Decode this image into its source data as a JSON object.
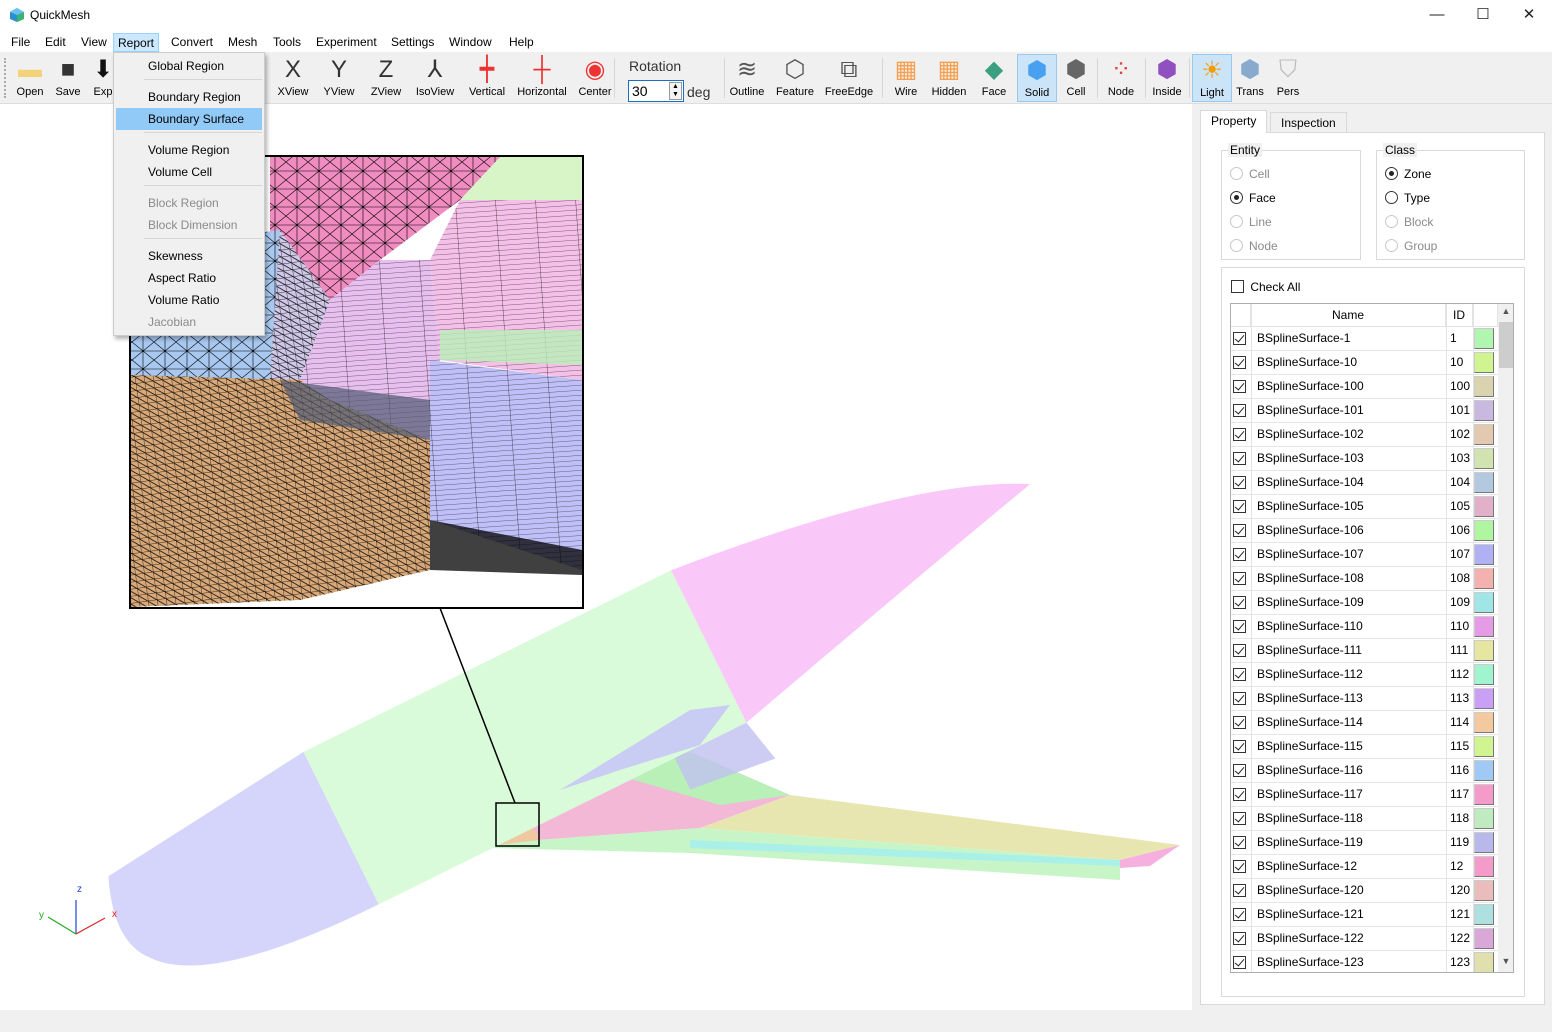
{
  "app": {
    "title": "QuickMesh",
    "window_controls": {
      "minimize": "—",
      "maximize": "☐",
      "close": "✕"
    }
  },
  "menu": [
    "File",
    "Edit",
    "View",
    "Report",
    "Convert",
    "Mesh",
    "Tools",
    "Experiment",
    "Settings",
    "Window",
    "Help"
  ],
  "active_menu": "Report",
  "report_menu": [
    {
      "label": "Global Region",
      "enabled": true
    },
    {
      "label": "Boundary Region",
      "enabled": true
    },
    {
      "label": "Boundary Surface",
      "enabled": true,
      "highlighted": true
    },
    {
      "label": "Volume Region",
      "enabled": true
    },
    {
      "label": "Volume Cell",
      "enabled": true
    },
    {
      "label": "Block Region",
      "enabled": false
    },
    {
      "label": "Block Dimension",
      "enabled": false
    },
    {
      "label": "Skewness",
      "enabled": true
    },
    {
      "label": "Aspect Ratio",
      "enabled": true
    },
    {
      "label": "Volume Ratio",
      "enabled": true
    },
    {
      "label": "Jacobian",
      "enabled": false
    }
  ],
  "toolbar": {
    "buttons": [
      {
        "label": "Open",
        "icon": "folder-icon"
      },
      {
        "label": "Save",
        "icon": "floppy-icon"
      },
      {
        "label": "Exp",
        "icon": "export-icon"
      },
      {
        "label": "XView",
        "icon": "x-view-icon"
      },
      {
        "label": "YView",
        "icon": "y-view-icon"
      },
      {
        "label": "ZView",
        "icon": "z-view-icon"
      },
      {
        "label": "IsoView",
        "icon": "iso-view-icon"
      },
      {
        "label": "Vertical",
        "icon": "rotate-vertical-icon"
      },
      {
        "label": "Horizontal",
        "icon": "rotate-horizontal-icon"
      },
      {
        "label": "Center",
        "icon": "center-icon"
      },
      {
        "label": "Outline",
        "icon": "outline-icon"
      },
      {
        "label": "Feature",
        "icon": "feature-icon"
      },
      {
        "label": "FreeEdge",
        "icon": "free-edge-icon"
      },
      {
        "label": "Wire",
        "icon": "wire-icon"
      },
      {
        "label": "Hidden",
        "icon": "hidden-icon"
      },
      {
        "label": "Face",
        "icon": "face-icon"
      },
      {
        "label": "Solid",
        "icon": "solid-icon",
        "active": true
      },
      {
        "label": "Cell",
        "icon": "cell-icon"
      },
      {
        "label": "Node",
        "icon": "node-icon"
      },
      {
        "label": "Inside",
        "icon": "inside-icon"
      },
      {
        "label": "Light",
        "icon": "light-icon",
        "active": true
      },
      {
        "label": "Trans",
        "icon": "transparent-icon"
      },
      {
        "label": "Pers",
        "icon": "perspective-icon"
      }
    ],
    "rotation": {
      "label": "Rotation",
      "value": "30",
      "unit": "deg"
    }
  },
  "viewport": {
    "axes": {
      "x": "x",
      "y": "y",
      "z": "z"
    }
  },
  "panel": {
    "tabs": [
      "Property",
      "Inspection"
    ],
    "active_tab": "Property",
    "entity": {
      "title": "Entity",
      "options": [
        {
          "label": "Cell",
          "enabled": false
        },
        {
          "label": "Face",
          "enabled": true,
          "selected": true
        },
        {
          "label": "Line",
          "enabled": false
        },
        {
          "label": "Node",
          "enabled": false
        }
      ]
    },
    "class": {
      "title": "Class",
      "options": [
        {
          "label": "Zone",
          "enabled": true,
          "selected": true
        },
        {
          "label": "Type",
          "enabled": true
        },
        {
          "label": "Block",
          "enabled": false
        },
        {
          "label": "Group",
          "enabled": false
        }
      ]
    },
    "check_all": {
      "label": "Check All",
      "checked": false
    },
    "table": {
      "columns": [
        "Name",
        "ID"
      ],
      "rows": [
        {
          "name": "BSplineSurface-1",
          "id": "1",
          "color": "#b0f5b0",
          "checked": true
        },
        {
          "name": "BSplineSurface-10",
          "id": "10",
          "color": "#d0f590",
          "checked": true
        },
        {
          "name": "BSplineSurface-100",
          "id": "100",
          "color": "#d9d3b0",
          "checked": true
        },
        {
          "name": "BSplineSurface-101",
          "id": "101",
          "color": "#c9b8e0",
          "checked": true
        },
        {
          "name": "BSplineSurface-102",
          "id": "102",
          "color": "#e3c9b0",
          "checked": true
        },
        {
          "name": "BSplineSurface-103",
          "id": "103",
          "color": "#d0e3b0",
          "checked": true
        },
        {
          "name": "BSplineSurface-104",
          "id": "104",
          "color": "#b3c9e0",
          "checked": true
        },
        {
          "name": "BSplineSurface-105",
          "id": "105",
          "color": "#e3b0c9",
          "checked": true
        },
        {
          "name": "BSplineSurface-106",
          "id": "106",
          "color": "#b0f5a0",
          "checked": true
        },
        {
          "name": "BSplineSurface-107",
          "id": "107",
          "color": "#b0b0f5",
          "checked": true
        },
        {
          "name": "BSplineSurface-108",
          "id": "108",
          "color": "#f5b0b0",
          "checked": true
        },
        {
          "name": "BSplineSurface-109",
          "id": "109",
          "color": "#a0e6e6",
          "checked": true
        },
        {
          "name": "BSplineSurface-110",
          "id": "110",
          "color": "#e69be6",
          "checked": true
        },
        {
          "name": "BSplineSurface-111",
          "id": "111",
          "color": "#e6e6a0",
          "checked": true
        },
        {
          "name": "BSplineSurface-112",
          "id": "112",
          "color": "#a0f5d0",
          "checked": true
        },
        {
          "name": "BSplineSurface-113",
          "id": "113",
          "color": "#c9a0f5",
          "checked": true
        },
        {
          "name": "BSplineSurface-114",
          "id": "114",
          "color": "#f5c9a0",
          "checked": true
        },
        {
          "name": "BSplineSurface-115",
          "id": "115",
          "color": "#d0f590",
          "checked": true
        },
        {
          "name": "BSplineSurface-116",
          "id": "116",
          "color": "#a0c9f5",
          "checked": true
        },
        {
          "name": "BSplineSurface-117",
          "id": "117",
          "color": "#f59bc9",
          "checked": true
        },
        {
          "name": "BSplineSurface-118",
          "id": "118",
          "color": "#c0ebc0",
          "checked": true
        },
        {
          "name": "BSplineSurface-119",
          "id": "119",
          "color": "#b8b8eb",
          "checked": true
        },
        {
          "name": "BSplineSurface-12",
          "id": "12",
          "color": "#f59bc9",
          "checked": true
        },
        {
          "name": "BSplineSurface-120",
          "id": "120",
          "color": "#ebbcbc",
          "checked": true
        },
        {
          "name": "BSplineSurface-121",
          "id": "121",
          "color": "#aee0e0",
          "checked": true
        },
        {
          "name": "BSplineSurface-122",
          "id": "122",
          "color": "#d9a8d9",
          "checked": true
        },
        {
          "name": "BSplineSurface-123",
          "id": "123",
          "color": "#e0e0ae",
          "checked": true
        }
      ]
    }
  }
}
